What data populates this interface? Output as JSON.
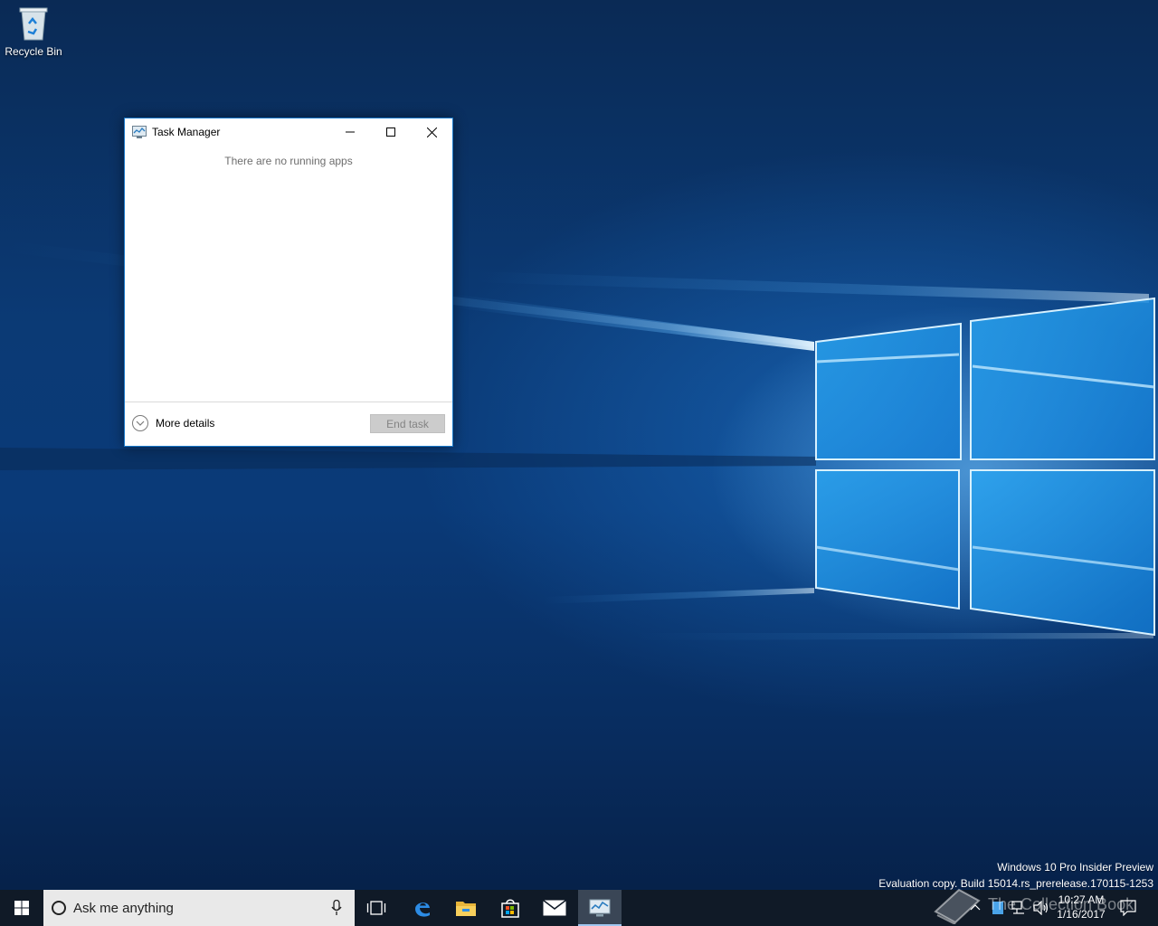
{
  "desktop": {
    "icons": [
      {
        "label": "Recycle Bin"
      }
    ],
    "watermark": {
      "line1": "Windows 10 Pro Insider Preview",
      "line2": "Evaluation copy. Build 15014.rs_prerelease.170115-1253"
    },
    "overlay_text": "The Collection Book"
  },
  "task_manager": {
    "title": "Task Manager",
    "empty_message": "There are no running apps",
    "more_details_label": "More details",
    "end_task_label": "End task",
    "controls": [
      "minimize-icon",
      "maximize-icon",
      "close-icon"
    ]
  },
  "taskbar": {
    "search_placeholder": "Ask me anything",
    "pinned": [
      "task-view-icon",
      "edge-icon",
      "file-explorer-icon",
      "store-icon",
      "mail-icon",
      "task-manager-icon"
    ],
    "active_item": "task-manager-icon",
    "clock": {
      "time": "10:27 AM",
      "date": "1/16/2017"
    }
  },
  "colors": {
    "taskbar_bg": "#101a27",
    "window_border": "#1979ca",
    "accent": "#0078d7"
  }
}
